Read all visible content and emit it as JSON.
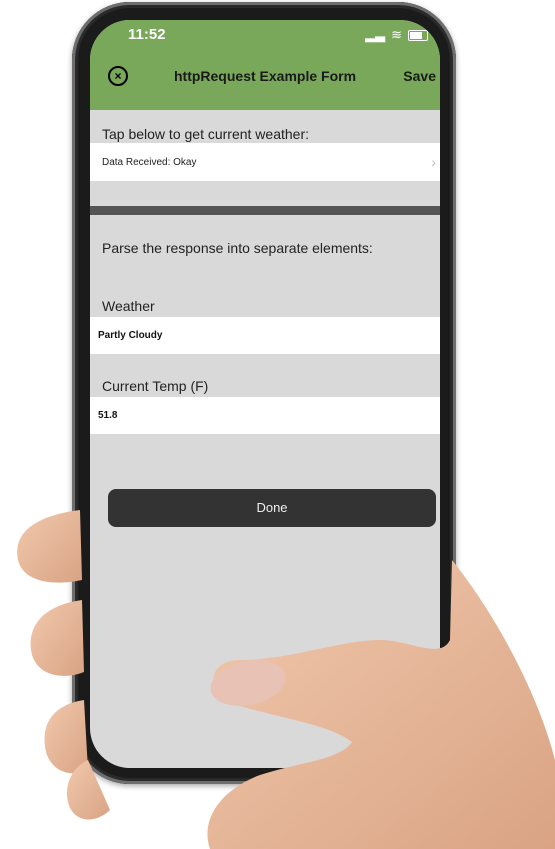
{
  "status": {
    "time": "11:52"
  },
  "nav": {
    "title": "httpRequest Example Form",
    "save_label": "Save"
  },
  "section1": {
    "prompt": "Tap below to get current weather:",
    "data_row": "Data Received: Okay"
  },
  "section2": {
    "prompt": "Parse the response into separate elements:",
    "weather_label": "Weather",
    "weather_value": "Partly Cloudy",
    "temp_label": "Current Temp (F)",
    "temp_value": "51.8"
  },
  "done_label": "Done",
  "colors": {
    "header": "#7aa85a",
    "screen_bg": "#d9d9d9",
    "done_bg": "#333333"
  }
}
